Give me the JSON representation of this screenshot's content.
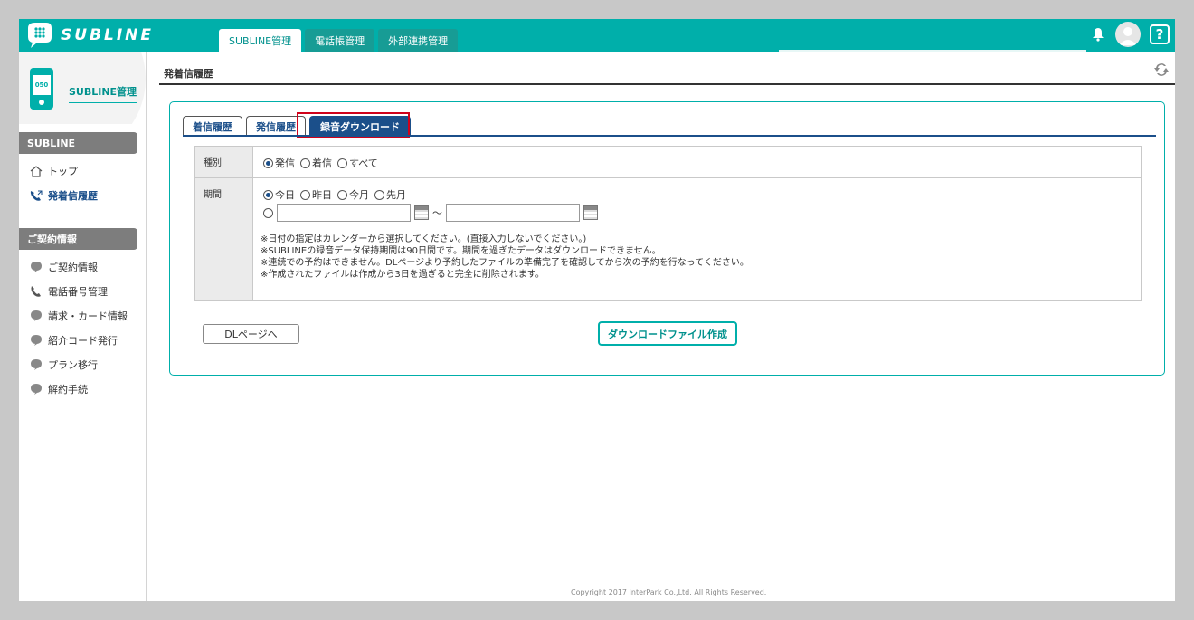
{
  "brand": {
    "name": "SUBLINE"
  },
  "top_tabs": [
    {
      "label": "SUBLINE管理",
      "active": true
    },
    {
      "label": "電話帳管理",
      "active": false
    },
    {
      "label": "外部連携管理",
      "active": false
    }
  ],
  "header_icons": {
    "bell": "bell-icon",
    "avatar": "user-avatar",
    "help": "?"
  },
  "sidebar": {
    "phone_label": "050",
    "title": "SUBLINE管理",
    "sections": [
      {
        "title": "SUBLINE",
        "items": [
          {
            "label": "トップ",
            "icon": "home-icon"
          },
          {
            "label": "発着信履歴",
            "icon": "phone-call-icon",
            "active": true
          }
        ]
      },
      {
        "title": "ご契約情報",
        "items": [
          {
            "label": "ご契約情報",
            "icon": "bubble-icon"
          },
          {
            "label": "電話番号管理",
            "icon": "phone-icon"
          },
          {
            "label": "請求・カード情報",
            "icon": "bubble-icon"
          },
          {
            "label": "紹介コード発行",
            "icon": "bubble-icon"
          },
          {
            "label": "プラン移行",
            "icon": "bubble-icon"
          },
          {
            "label": "解約手続",
            "icon": "bubble-icon"
          }
        ]
      }
    ]
  },
  "page": {
    "title": "発着信履歴"
  },
  "tabs": [
    {
      "label": "着信履歴",
      "active": false
    },
    {
      "label": "発信履歴",
      "active": false
    },
    {
      "label": "録音ダウンロード",
      "active": true
    }
  ],
  "form": {
    "kind": {
      "label": "種別",
      "options": [
        "発信",
        "着信",
        "すべて"
      ],
      "selected": "発信"
    },
    "period": {
      "label": "期間",
      "options": [
        "今日",
        "昨日",
        "今月",
        "先月"
      ],
      "selected": "今日",
      "range_separator": "～",
      "from_value": "",
      "to_value": ""
    },
    "notes": [
      "※日付の指定はカレンダーから選択してください。(直接入力しないでください。)",
      "※SUBLINEの録音データ保持期間は90日間です。期間を過ぎたデータはダウンロードできません。",
      "※連続での予約はできません。DLページより予約したファイルの準備完了を確認してから次の予約を行なってください。",
      "※作成されたファイルは作成から3日を過ぎると完全に削除されます。"
    ]
  },
  "buttons": {
    "dl_page": "DLページへ",
    "create": "ダウンロードファイル作成"
  },
  "footer": {
    "copyright": "Copyright 2017 InterPark Co.,Ltd. All Rights Reserved."
  },
  "colors": {
    "brand": "#00afaa",
    "nav": "#1b4f8a",
    "highlight": "#d0021b"
  }
}
